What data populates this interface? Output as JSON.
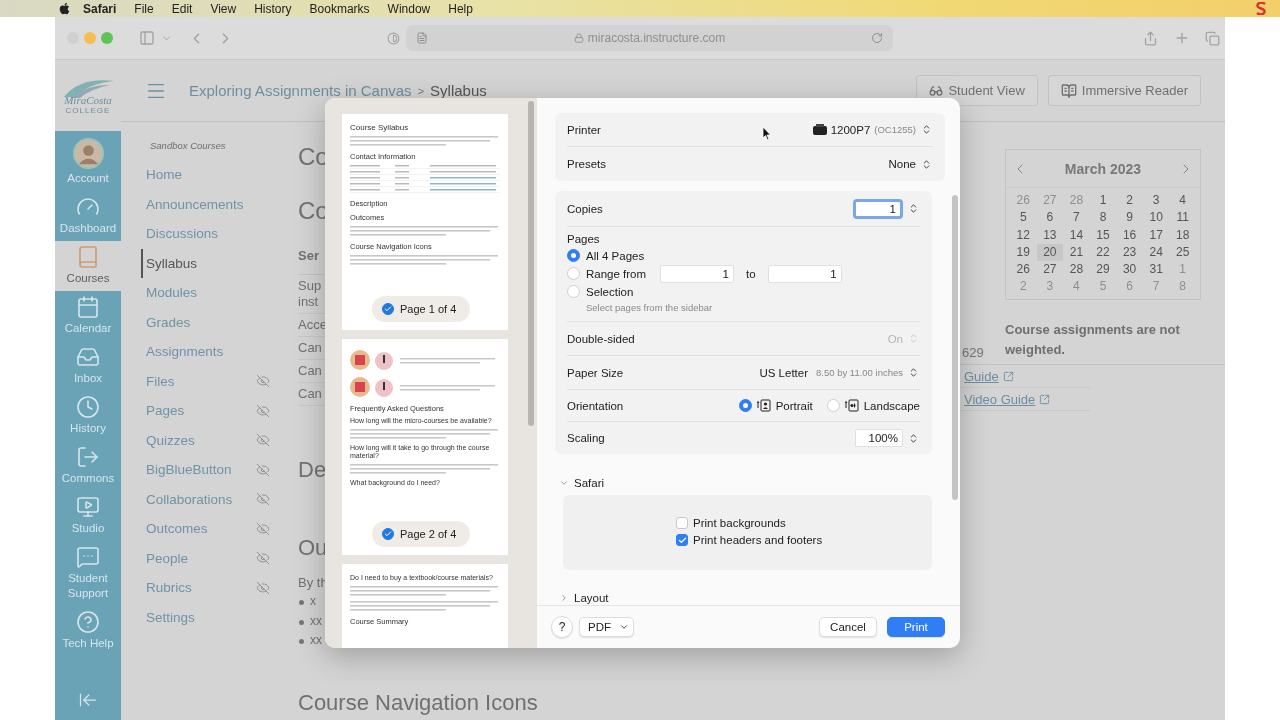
{
  "menubar": {
    "app": "Safari",
    "menus": [
      "File",
      "Edit",
      "View",
      "History",
      "Bookmarks",
      "Window",
      "Help"
    ]
  },
  "browser": {
    "address": "miracosta.instructure.com"
  },
  "header": {
    "logo_text": "MiraCosta",
    "logo_subtext": "COLLEGE",
    "breadcrumb": [
      "Exploring Assignments in Canvas",
      "Syllabus"
    ],
    "separator": ">",
    "buttons": [
      {
        "label": "Student View",
        "kind": "glasses"
      },
      {
        "label": "Immersive Reader",
        "kind": "reader"
      }
    ]
  },
  "global_nav": [
    {
      "label": "Account",
      "kind": "avatar",
      "selected": false
    },
    {
      "label": "Dashboard",
      "kind": "dashboard",
      "selected": false
    },
    {
      "label": "Courses",
      "kind": "courses",
      "selected": true
    },
    {
      "label": "Calendar",
      "kind": "calendar",
      "selected": false
    },
    {
      "label": "Inbox",
      "kind": "inbox",
      "selected": false
    },
    {
      "label": "History",
      "kind": "history",
      "selected": false
    },
    {
      "label": "Commons",
      "kind": "commons",
      "selected": false
    },
    {
      "label": "Studio",
      "kind": "studio",
      "selected": false
    },
    {
      "label": "Student Support",
      "kind": "support",
      "selected": false
    },
    {
      "label": "Tech Help",
      "kind": "help",
      "selected": false
    }
  ],
  "course_nav": {
    "title": "Sandbox Courses",
    "items": [
      {
        "label": "Home",
        "selected": false,
        "hidden": false
      },
      {
        "label": "Announcements",
        "selected": false,
        "hidden": false
      },
      {
        "label": "Discussions",
        "selected": false,
        "hidden": false
      },
      {
        "label": "Syllabus",
        "selected": true,
        "hidden": false
      },
      {
        "label": "Modules",
        "selected": false,
        "hidden": false
      },
      {
        "label": "Grades",
        "selected": false,
        "hidden": false
      },
      {
        "label": "Assignments",
        "selected": false,
        "hidden": false
      },
      {
        "label": "Files",
        "selected": false,
        "hidden": true
      },
      {
        "label": "Pages",
        "selected": false,
        "hidden": true
      },
      {
        "label": "Quizzes",
        "selected": false,
        "hidden": true
      },
      {
        "label": "BigBlueButton",
        "selected": false,
        "hidden": true
      },
      {
        "label": "Collaborations",
        "selected": false,
        "hidden": true
      },
      {
        "label": "Outcomes",
        "selected": false,
        "hidden": true
      },
      {
        "label": "People",
        "selected": false,
        "hidden": true
      },
      {
        "label": "Rubrics",
        "selected": false,
        "hidden": true
      },
      {
        "label": "Settings",
        "selected": false,
        "hidden": false
      }
    ]
  },
  "main_fragments": [
    {
      "kind": "h1",
      "text": "Co"
    },
    {
      "kind": "h2",
      "text": "Co"
    },
    {
      "kind": "th",
      "text": "Ser"
    },
    {
      "kind": "td",
      "text": "Sup inst"
    },
    {
      "kind": "td",
      "text": "Acce"
    },
    {
      "kind": "td",
      "text": "Can"
    },
    {
      "kind": "td",
      "text": "Can"
    },
    {
      "kind": "td",
      "text": "Can"
    },
    {
      "kind": "section",
      "text": "De"
    },
    {
      "kind": "section",
      "text": "Ou"
    },
    {
      "kind": "para",
      "text": "By th"
    },
    {
      "kind": "bullet",
      "text": "x"
    },
    {
      "kind": "bullet",
      "text": "xx"
    },
    {
      "kind": "bullet",
      "text": "xx"
    }
  ],
  "bottom_heading": "Course Navigation Icons",
  "calendar": {
    "title": "March 2023",
    "days": [
      {
        "d": "26",
        "muted": true,
        "selected": false
      },
      {
        "d": "27",
        "muted": true,
        "selected": false
      },
      {
        "d": "28",
        "muted": true,
        "selected": false
      },
      {
        "d": "1",
        "muted": false,
        "selected": false
      },
      {
        "d": "2",
        "muted": false,
        "selected": false
      },
      {
        "d": "3",
        "muted": false,
        "selected": false
      },
      {
        "d": "4",
        "muted": false,
        "selected": false
      },
      {
        "d": "5",
        "muted": false,
        "selected": false
      },
      {
        "d": "6",
        "muted": false,
        "selected": false
      },
      {
        "d": "7",
        "muted": false,
        "selected": false
      },
      {
        "d": "8",
        "muted": false,
        "selected": false
      },
      {
        "d": "9",
        "muted": false,
        "selected": false
      },
      {
        "d": "10",
        "muted": false,
        "selected": false
      },
      {
        "d": "11",
        "muted": false,
        "selected": false
      },
      {
        "d": "12",
        "muted": false,
        "selected": false
      },
      {
        "d": "13",
        "muted": false,
        "selected": false
      },
      {
        "d": "14",
        "muted": false,
        "selected": false
      },
      {
        "d": "15",
        "muted": false,
        "selected": false
      },
      {
        "d": "16",
        "muted": false,
        "selected": false
      },
      {
        "d": "17",
        "muted": false,
        "selected": false
      },
      {
        "d": "18",
        "muted": false,
        "selected": false
      },
      {
        "d": "19",
        "muted": false,
        "selected": false
      },
      {
        "d": "20",
        "muted": false,
        "selected": true
      },
      {
        "d": "21",
        "muted": false,
        "selected": false
      },
      {
        "d": "22",
        "muted": false,
        "selected": false
      },
      {
        "d": "23",
        "muted": false,
        "selected": false
      },
      {
        "d": "24",
        "muted": false,
        "selected": false
      },
      {
        "d": "25",
        "muted": false,
        "selected": false
      },
      {
        "d": "26",
        "muted": false,
        "selected": false
      },
      {
        "d": "27",
        "muted": false,
        "selected": false
      },
      {
        "d": "28",
        "muted": false,
        "selected": false
      },
      {
        "d": "29",
        "muted": false,
        "selected": false
      },
      {
        "d": "30",
        "muted": false,
        "selected": false
      },
      {
        "d": "31",
        "muted": false,
        "selected": false
      },
      {
        "d": "1",
        "muted": true,
        "selected": false
      },
      {
        "d": "2",
        "muted": true,
        "selected": false
      },
      {
        "d": "3",
        "muted": true,
        "selected": false
      },
      {
        "d": "4",
        "muted": true,
        "selected": false
      },
      {
        "d": "5",
        "muted": true,
        "selected": false
      },
      {
        "d": "6",
        "muted": true,
        "selected": false
      },
      {
        "d": "7",
        "muted": true,
        "selected": false
      },
      {
        "d": "8",
        "muted": true,
        "selected": false
      }
    ]
  },
  "grading_note": "Course assignments are not weighted.",
  "right_fragments": [
    {
      "kind": "td",
      "text": "629"
    },
    {
      "kind": "link",
      "text": "Guide"
    },
    {
      "kind": "link",
      "text": "Video Guide"
    }
  ],
  "print_dialog": {
    "previews": [
      {
        "label": "Page 1 of 4",
        "selected": true,
        "blocks": [
          {
            "kind": "title",
            "text": "Course Syllabus"
          },
          {
            "kind": "lines"
          },
          {
            "kind": "heading",
            "text": "Contact Information"
          },
          {
            "kind": "table"
          },
          {
            "kind": "heading",
            "text": "Description"
          },
          {
            "kind": "heading",
            "text": "Outcomes"
          },
          {
            "kind": "lines"
          },
          {
            "kind": "heading",
            "text": "Course Navigation Icons"
          },
          {
            "kind": "lines"
          }
        ]
      },
      {
        "label": "Page 2 of 4",
        "selected": true,
        "blocks": [
          {
            "kind": "icons"
          },
          {
            "kind": "icons"
          },
          {
            "kind": "heading",
            "text": "Frequently Asked Questions"
          },
          {
            "kind": "subheading",
            "text": "How long will the micro-courses be available?"
          },
          {
            "kind": "lines"
          },
          {
            "kind": "subheading",
            "text": "How long will it take to go through the course material?"
          },
          {
            "kind": "lines"
          },
          {
            "kind": "subheading",
            "text": "What background do I need?"
          }
        ]
      },
      {
        "blocks": [
          {
            "kind": "subheading",
            "text": "Do I need to buy a textbook/course materials?"
          },
          {
            "kind": "lines"
          },
          {
            "kind": "lines"
          },
          {
            "kind": "heading",
            "text": "Course Summary"
          }
        ]
      }
    ],
    "printer": {
      "label": "Printer",
      "value": "1200P7",
      "detail": "(OC1255)"
    },
    "presets": {
      "label": "Presets",
      "value": "None"
    },
    "copies": {
      "label": "Copies",
      "value": "1"
    },
    "pages_label": "Pages",
    "page_options": [
      {
        "kind": "plain",
        "label": "All 4 Pages",
        "selected": true
      },
      {
        "kind": "range",
        "label": "Range from",
        "selected": false,
        "from": "1",
        "to_label": "to",
        "to": "1"
      },
      {
        "kind": "hint",
        "label": "Selection",
        "selected": false,
        "hint": "Select pages from the sidebar"
      }
    ],
    "double_sided": {
      "label": "Double-sided",
      "value": "On",
      "disabled": true
    },
    "paper": {
      "label": "Paper Size",
      "value": "US Letter",
      "detail": "8.50 by 11.00 inches"
    },
    "orientation": {
      "label": "Orientation",
      "options": [
        {
          "kind": "portrait",
          "label": "Portrait",
          "selected": true
        },
        {
          "kind": "landscape",
          "label": "Landscape",
          "selected": false
        }
      ]
    },
    "scaling": {
      "label": "Scaling",
      "value": "100%"
    },
    "safari_section": {
      "title": "Safari",
      "expanded": true,
      "options": [
        {
          "label": "Print backgrounds",
          "checked": false
        },
        {
          "label": "Print headers and footers",
          "checked": true
        }
      ]
    },
    "layout_section": {
      "title": "Layout",
      "expanded": false
    },
    "help": "?",
    "pdf": "PDF",
    "cancel": "Cancel",
    "print": "Print"
  }
}
